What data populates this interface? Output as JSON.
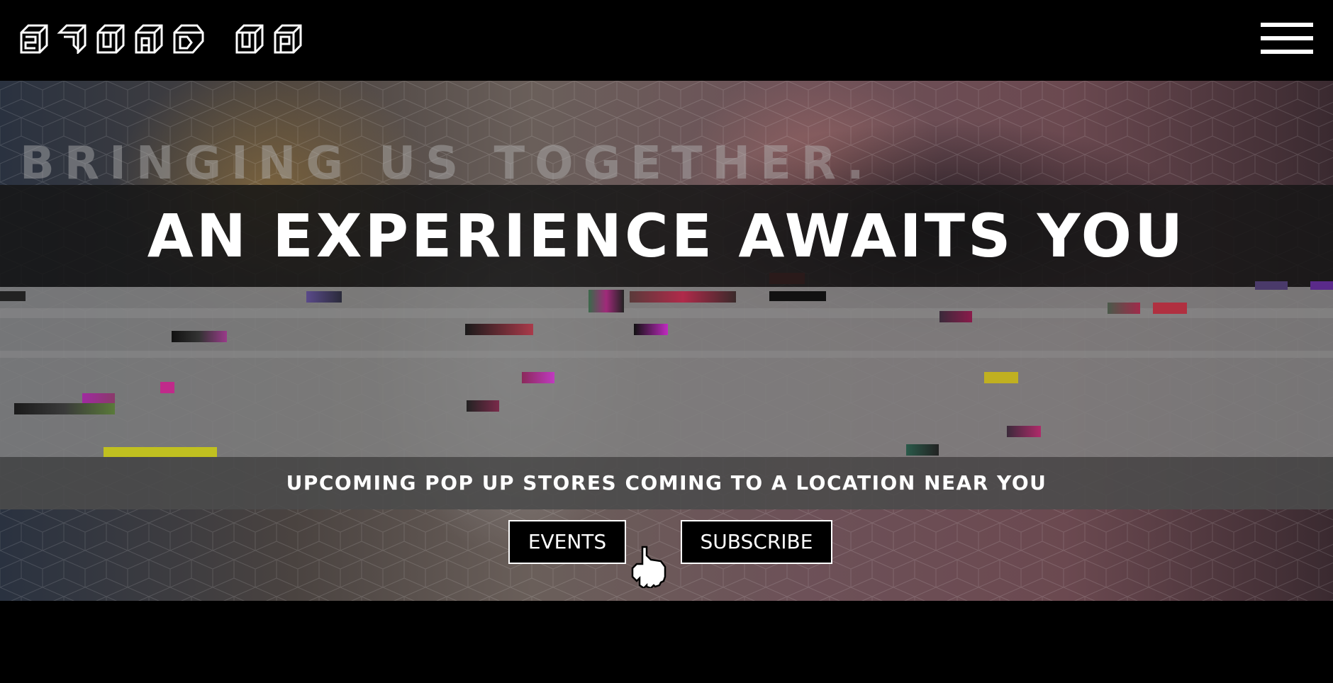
{
  "header": {
    "logo_text": "SQUAD UP",
    "logo_icon": "squad-up-logo",
    "menu_icon": "hamburger-menu-icon"
  },
  "hero": {
    "tagline": "BRINGING US TOGETHER.",
    "headline": "AN EXPERIENCE AWAITS YOU",
    "subheadline": "UPCOMING POP UP STORES COMING TO A LOCATION NEAR YOU",
    "buttons": {
      "events_label": "EVENTS",
      "subscribe_label": "SUBSCRIBE"
    },
    "cursor_icon": "hand-pointer-icon"
  },
  "colors": {
    "background": "#000000",
    "text": "#ffffff",
    "headline_band": "#161616",
    "grey_panel": "#808080"
  }
}
